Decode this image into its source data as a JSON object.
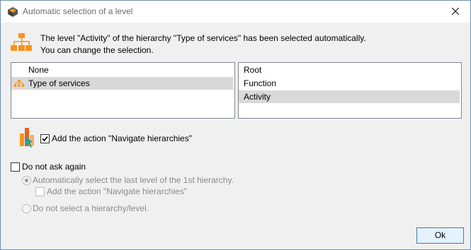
{
  "window": {
    "title": "Automatic selection of a level"
  },
  "message": {
    "line1": "The level \"Activity\" of the hierarchy \"Type of services\" has been selected automatically.",
    "line2": "You can change the selection."
  },
  "hierarchies": {
    "items": [
      {
        "label": "None",
        "selected": false
      },
      {
        "label": "Type of services",
        "selected": true
      }
    ]
  },
  "levels": {
    "items": [
      {
        "label": "Root",
        "selected": false
      },
      {
        "label": "Function",
        "selected": false
      },
      {
        "label": "Activity",
        "selected": true
      }
    ]
  },
  "navigate_option": {
    "label": "Add the action \"Navigate hierarchies\"",
    "checked": true
  },
  "do_not_ask": {
    "label": "Do not ask again",
    "checked": false,
    "auto_select": {
      "label": "Automatically select the last level of the 1st hierarchy.",
      "selected": true
    },
    "auto_navigate": {
      "label": "Add the action \"Navigate hierarchies\"",
      "checked": false
    },
    "no_select": {
      "label": "Do not select a hierarchy/level.",
      "selected": false
    }
  },
  "buttons": {
    "ok": "Ok"
  },
  "colors": {
    "accent_orange": "#f7941d",
    "teal": "#1aa7a0",
    "selection": "#d9d9d9"
  },
  "icons": [
    "app-icon",
    "close-icon",
    "hierarchy-icon",
    "navigate-icon",
    "check-icon"
  ]
}
